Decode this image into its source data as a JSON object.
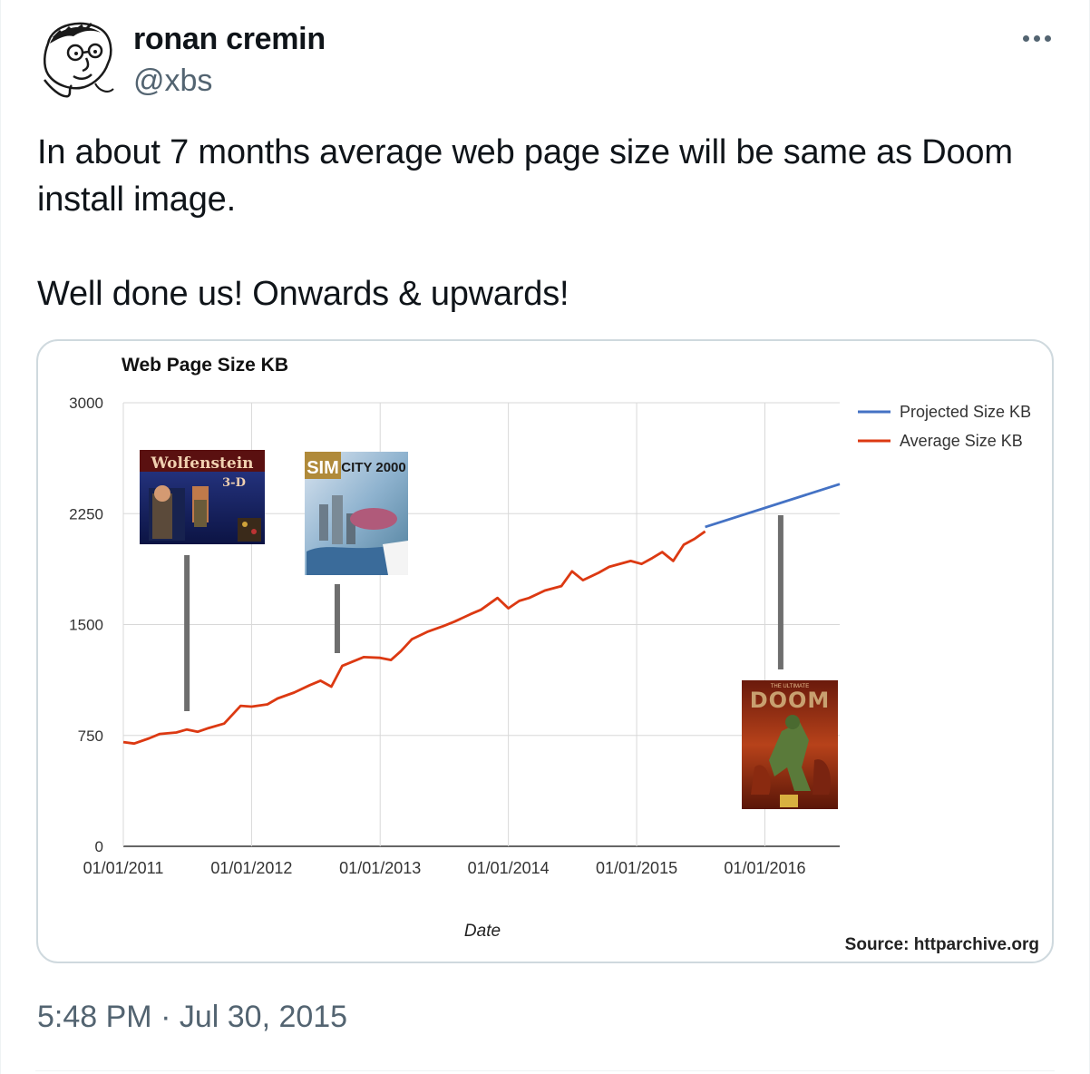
{
  "author": {
    "name": "ronan cremin",
    "handle": "@xbs",
    "avatar_icon": "sketch-face-avatar-icon"
  },
  "more_icon": "more-dots-icon",
  "tweet": {
    "lines": [
      "In about 7 months average web page size will be same as Doom",
      "install image."
    ],
    "line2": "Well done us! Onwards & upwards!",
    "timestamp": "5:48 PM · Jul 30, 2015"
  },
  "chart_data": {
    "type": "line",
    "title": "Web Page Size KB",
    "xlabel": "Date",
    "ylabel": "",
    "ylim": [
      0,
      3000
    ],
    "yticks": [
      "0",
      "750",
      "1500",
      "2250",
      "3000"
    ],
    "xticks": [
      "01/01/2011",
      "01/01/2012",
      "01/01/2013",
      "01/01/2014",
      "01/01/2015",
      "01/01/2016"
    ],
    "xlim": [
      "2011-01-01",
      "2016-08-01"
    ],
    "grid": true,
    "legend_position": "right",
    "source": "Source: httparchive.org",
    "series": [
      {
        "name": "Projected Size KB",
        "color": "#4472c4",
        "points": [
          [
            "2015-07-15",
            2160
          ],
          [
            "2016-08-01",
            2450
          ]
        ]
      },
      {
        "name": "Average Size KB",
        "color": "#dc3912",
        "points": [
          [
            "2011-01-01",
            705
          ],
          [
            "2011-02-01",
            695
          ],
          [
            "2011-03-15",
            730
          ],
          [
            "2011-04-15",
            760
          ],
          [
            "2011-06-01",
            770
          ],
          [
            "2011-07-01",
            790
          ],
          [
            "2011-08-01",
            775
          ],
          [
            "2011-09-01",
            800
          ],
          [
            "2011-10-15",
            830
          ],
          [
            "2011-12-01",
            950
          ],
          [
            "2012-01-01",
            945
          ],
          [
            "2012-02-15",
            960
          ],
          [
            "2012-03-15",
            1000
          ],
          [
            "2012-05-01",
            1040
          ],
          [
            "2012-06-15",
            1090
          ],
          [
            "2012-07-15",
            1120
          ],
          [
            "2012-08-15",
            1080
          ],
          [
            "2012-09-15",
            1220
          ],
          [
            "2012-10-15",
            1250
          ],
          [
            "2012-11-15",
            1280
          ],
          [
            "2013-01-01",
            1275
          ],
          [
            "2013-02-01",
            1260
          ],
          [
            "2013-03-01",
            1320
          ],
          [
            "2013-04-01",
            1400
          ],
          [
            "2013-05-15",
            1450
          ],
          [
            "2013-07-01",
            1490
          ],
          [
            "2013-08-01",
            1520
          ],
          [
            "2013-09-15",
            1570
          ],
          [
            "2013-10-15",
            1600
          ],
          [
            "2013-12-01",
            1680
          ],
          [
            "2014-01-01",
            1610
          ],
          [
            "2014-02-01",
            1660
          ],
          [
            "2014-03-01",
            1680
          ],
          [
            "2014-04-15",
            1730
          ],
          [
            "2014-06-01",
            1760
          ],
          [
            "2014-07-01",
            1860
          ],
          [
            "2014-08-01",
            1800
          ],
          [
            "2014-09-15",
            1850
          ],
          [
            "2014-10-15",
            1890
          ],
          [
            "2014-12-15",
            1930
          ],
          [
            "2015-01-15",
            1910
          ],
          [
            "2015-02-15",
            1950
          ],
          [
            "2015-03-15",
            1990
          ],
          [
            "2015-04-15",
            1930
          ],
          [
            "2015-05-15",
            2040
          ],
          [
            "2015-06-15",
            2080
          ],
          [
            "2015-07-15",
            2130
          ]
        ]
      }
    ],
    "annotations": [
      {
        "name": "Wolfenstein 3-D",
        "cover_title": "Wolfenstein",
        "cover_subtitle": "3-D",
        "x": "2011-07-01"
      },
      {
        "name": "SimCity 2000",
        "cover_title": "SIM",
        "cover_subtitle": "CITY 2000",
        "x": "2012-09-01"
      },
      {
        "name": "Doom",
        "cover_title": "DOOM",
        "cover_subtitle": "THE ULTIMATE",
        "x": "2016-02-15"
      }
    ]
  }
}
